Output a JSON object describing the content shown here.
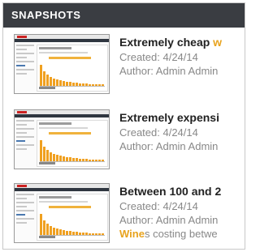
{
  "panel": {
    "title": "SNAPSHOTS"
  },
  "colors": {
    "header_bg": "#3a3d42",
    "accent": "#e8a31e",
    "meta_text": "#888888",
    "chart_bars": "#f0a020"
  },
  "snapshots": [
    {
      "title_prefix": "Extremely cheap ",
      "title_highlight": "w",
      "created": "Created: 4/24/14",
      "author": "Author: Admin Admin",
      "thumbnail_icon": "report-thumbnail"
    },
    {
      "title_prefix": "Extremely expensi",
      "title_highlight": "",
      "created": "Created: 4/24/14",
      "author": "Author: Admin Admin",
      "thumbnail_icon": "report-thumbnail"
    },
    {
      "title_prefix": "Between 100 and 2",
      "title_highlight": "",
      "created": "Created: 4/24/14",
      "author": "Author: Admin Admin",
      "desc_highlight": "Wine",
      "desc_rest": "s costing betwe",
      "thumbnail_icon": "report-thumbnail"
    }
  ]
}
